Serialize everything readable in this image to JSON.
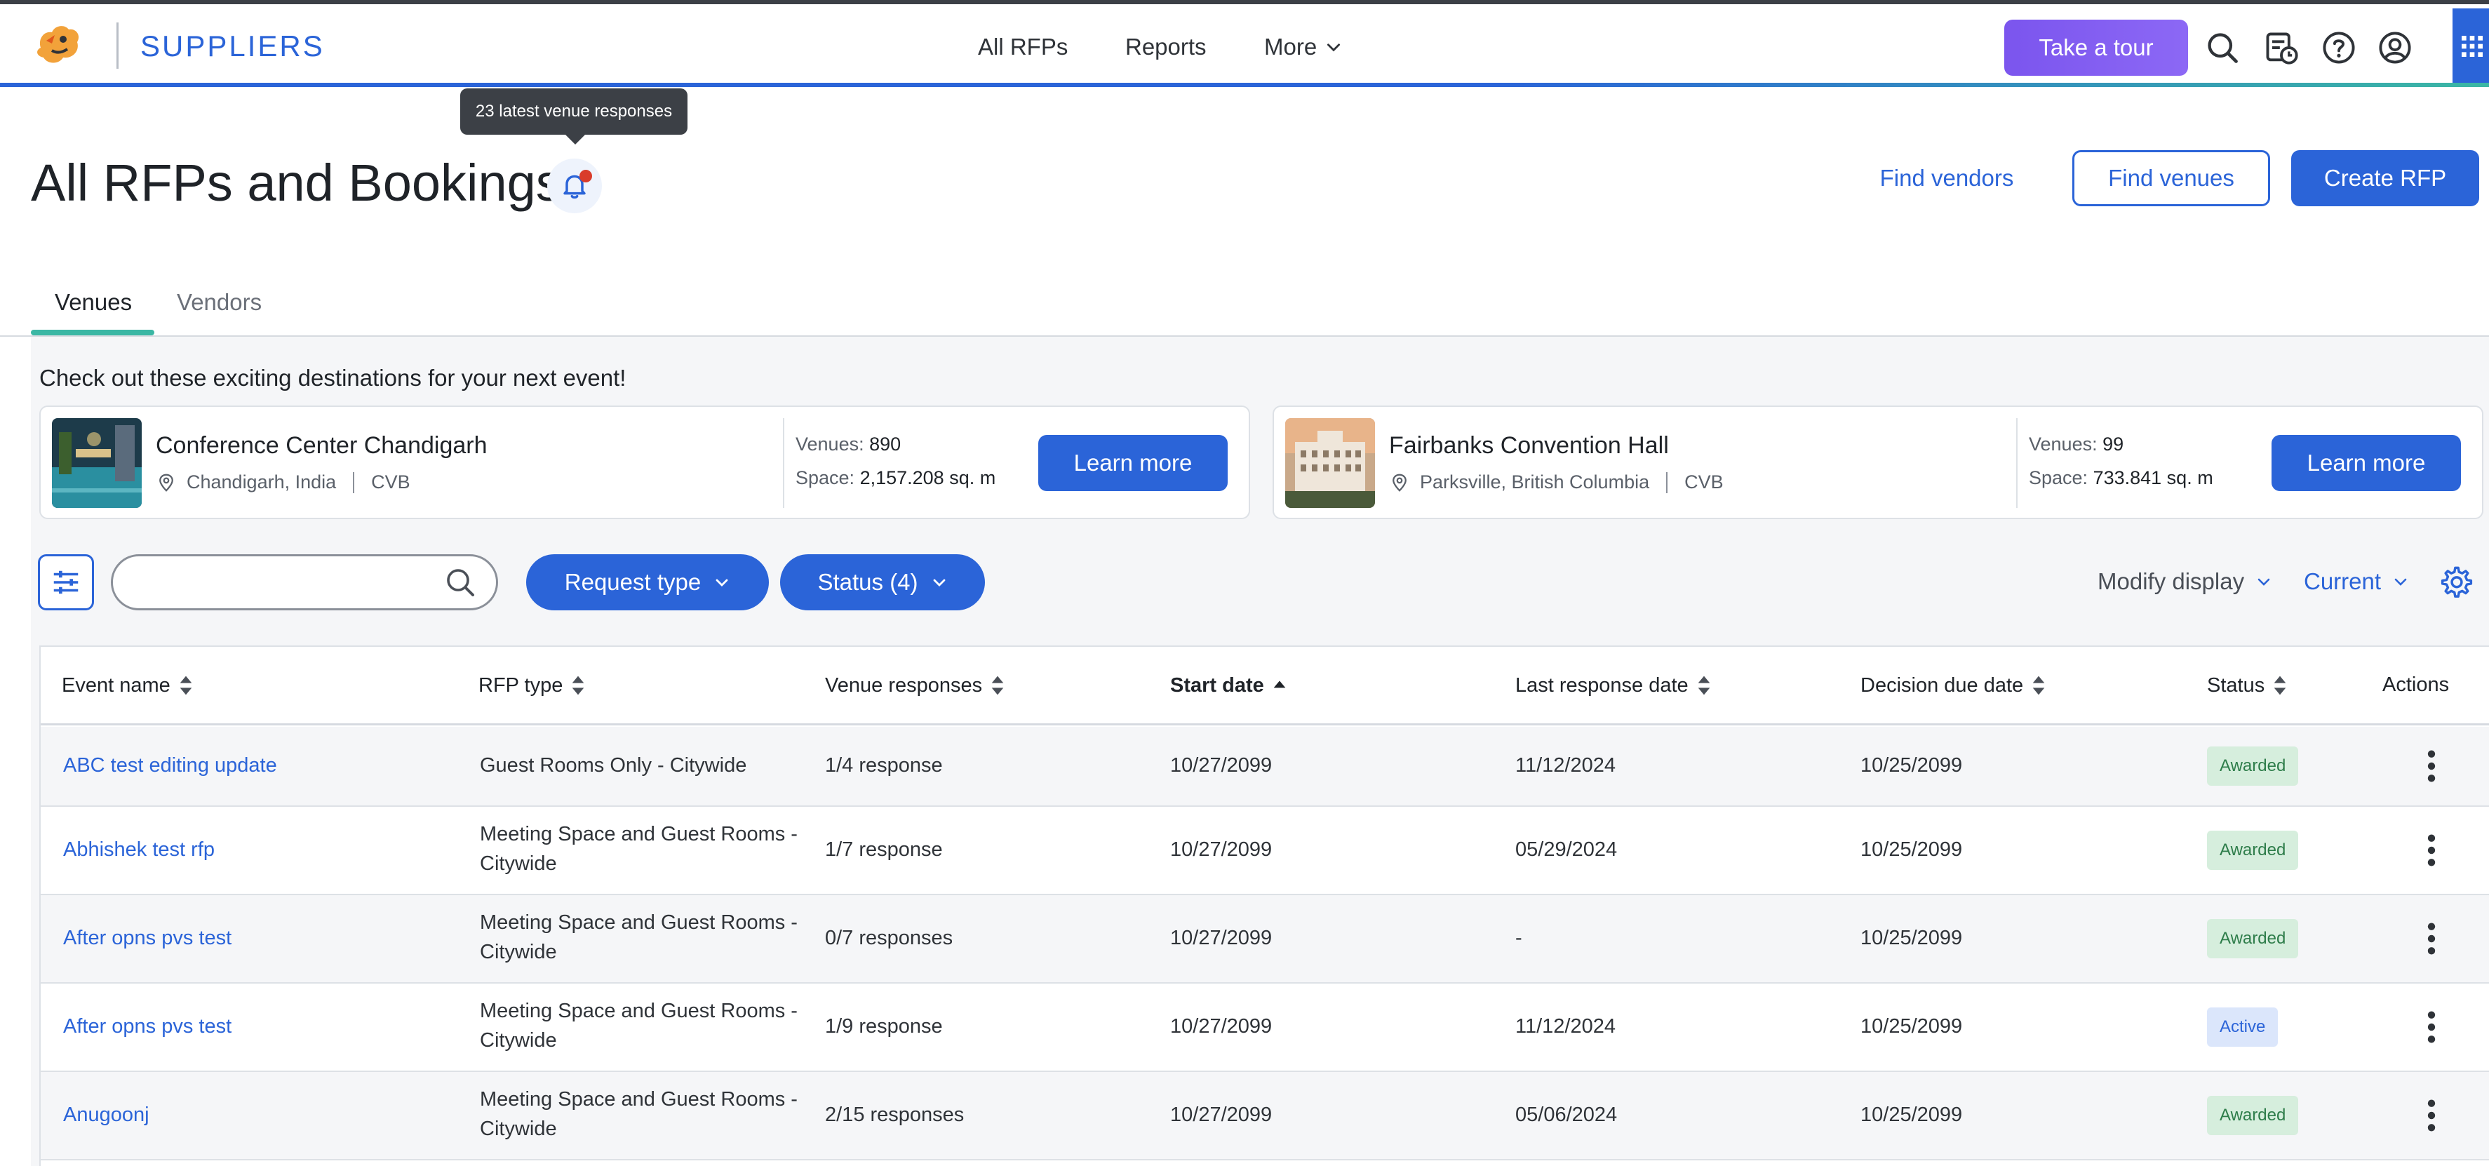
{
  "nav": {
    "brand": "SUPPLIERS",
    "links": [
      "All RFPs",
      "Reports",
      "More"
    ],
    "tour_label": "Take a tour",
    "icons": [
      "search-icon",
      "calendar-clock-icon",
      "help-icon",
      "account-icon",
      "apps-grid-icon"
    ]
  },
  "header": {
    "tooltip": "23 latest venue responses",
    "title": "All RFPs and Bookings",
    "find_vendors": "Find vendors",
    "find_venues": "Find venues",
    "create_rfp": "Create RFP"
  },
  "tabs": [
    {
      "label": "Venues",
      "active": true
    },
    {
      "label": "Vendors",
      "active": false
    }
  ],
  "promo": {
    "heading": "Check out these exciting destinations for your next event!",
    "cards": [
      {
        "name": "Conference Center Chandigarh",
        "location": "Chandigarh, India",
        "type": "CVB",
        "venues_label": "Venues:",
        "venues": "890",
        "space_label": "Space:",
        "space": "2,157.208 sq. m",
        "button": "Learn more"
      },
      {
        "name": "Fairbanks Convention Hall",
        "location": "Parksville, British Columbia",
        "type": "CVB",
        "venues_label": "Venues:",
        "venues": "99",
        "space_label": "Space:",
        "space": "733.841 sq. m",
        "button": "Learn more"
      }
    ]
  },
  "filters": {
    "search_value": "",
    "search_placeholder": "",
    "request_type": "Request type",
    "status": "Status (4)",
    "modify_display": "Modify display",
    "current": "Current"
  },
  "table": {
    "columns": [
      "Event name",
      "RFP type",
      "Venue responses",
      "Start date",
      "Last response date",
      "Decision due date",
      "Status",
      "Actions"
    ],
    "sorted_column": "Start date",
    "rows": [
      {
        "event": "ABC test editing update",
        "rfp_type_1": "Guest Rooms Only - Citywide",
        "rfp_type_2": "",
        "responses": "1/4 response",
        "start": "10/27/2099",
        "last": "11/12/2024",
        "due": "10/25/2099",
        "status": "Awarded"
      },
      {
        "event": "Abhishek test rfp",
        "rfp_type_1": "Meeting Space and Guest Rooms -",
        "rfp_type_2": "Citywide",
        "responses": "1/7 response",
        "start": "10/27/2099",
        "last": "05/29/2024",
        "due": "10/25/2099",
        "status": "Awarded"
      },
      {
        "event": "After opns pvs test",
        "rfp_type_1": "Meeting Space and Guest Rooms -",
        "rfp_type_2": "Citywide",
        "responses": "0/7 responses",
        "start": "10/27/2099",
        "last": "-",
        "due": "10/25/2099",
        "status": "Awarded"
      },
      {
        "event": "After opns pvs test",
        "rfp_type_1": "Meeting Space and Guest Rooms -",
        "rfp_type_2": "Citywide",
        "responses": "1/9 response",
        "start": "10/27/2099",
        "last": "11/12/2024",
        "due": "10/25/2099",
        "status": "Active"
      },
      {
        "event": "Anugoonj",
        "rfp_type_1": "Meeting Space and Guest Rooms -",
        "rfp_type_2": "Citywide",
        "responses": "2/15 responses",
        "start": "10/27/2099",
        "last": "05/06/2024",
        "due": "10/25/2099",
        "status": "Awarded"
      }
    ]
  },
  "colors": {
    "primary": "#2b64d8",
    "tour": "#7b55ee",
    "accent_teal": "#3bb7a4",
    "awarded_bg": "#d6eedd",
    "active_bg": "#dbe6fb"
  }
}
